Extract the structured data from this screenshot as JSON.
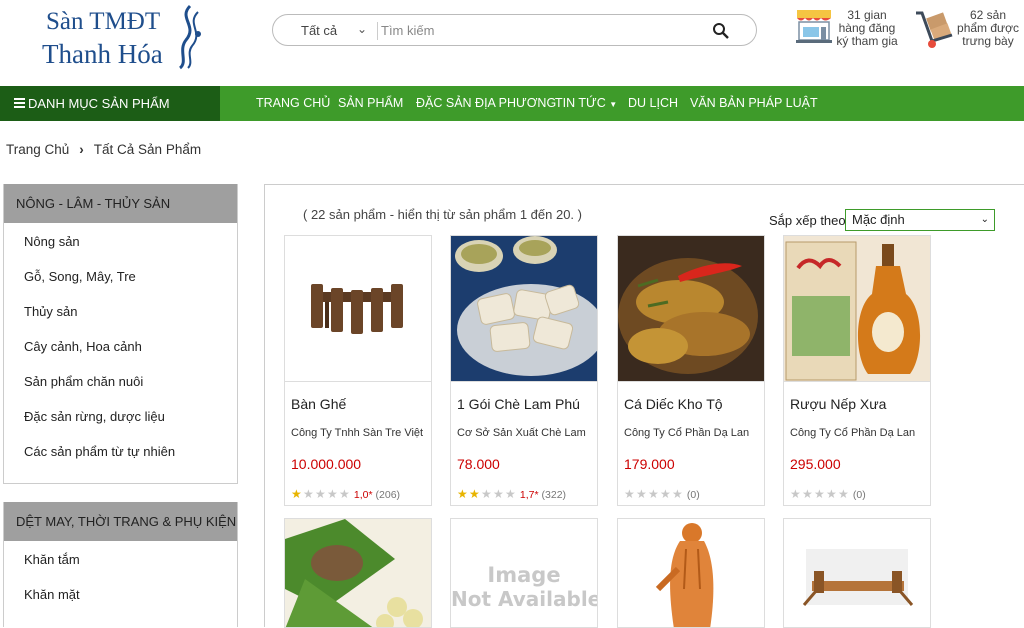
{
  "logo": {
    "line1": "Sàn TMĐT",
    "line2": "Thanh Hóa"
  },
  "search": {
    "category": "Tất cả",
    "placeholder": "Tìm kiếm"
  },
  "stats": [
    {
      "icon": "shop-stall-icon",
      "text": "31 gian hàng đăng ký tham gia"
    },
    {
      "icon": "hand-truck-icon",
      "text": "62 sản phẩm được trưng bày"
    }
  ],
  "nav": {
    "category_menu": "DANH MỤC SẢN PHẨM",
    "items": [
      "TRANG CHỦ",
      "SẢN PHẨM",
      "ĐẶC SẢN ĐỊA PHƯƠNG",
      "TIN TỨC",
      "DU LỊCH",
      "VĂN BẢN PHÁP LUẬT"
    ]
  },
  "breadcrumb": [
    "Trang Chủ",
    "Tất Cả Sản Phẩm"
  ],
  "sidebar": [
    {
      "title": "NÔNG - LÂM - THỦY SẢN",
      "items": [
        "Nông sản",
        "Gỗ, Song, Mây, Tre",
        "Thủy sản",
        "Cây cảnh, Hoa cảnh",
        "Sản phẩm chăn nuôi",
        "Đặc sản rừng, dược liệu",
        "Các sản phẩm từ tự nhiên"
      ]
    },
    {
      "title": "DỆT MAY, THỜI TRANG & PHỤ KIỆN",
      "items": [
        "Khăn tắm",
        "Khăn mặt"
      ]
    }
  ],
  "listing": {
    "count_text": "( 22 sản phẩm - hiển thị từ sản phẩm 1 đến 20. )",
    "sort_label": "Sắp xếp theo",
    "sort_value": "Mặc định"
  },
  "products": [
    {
      "name": "Bàn Ghế",
      "company": "Công Ty Tnhh Sàn Tre Việt",
      "price": "10.000.000",
      "stars": 1,
      "rating": "1,0*",
      "reviews": "(206)",
      "image": "table-chairs-image"
    },
    {
      "name": "1 Gói Chè Lam Phú",
      "company": "Cơ Sở Sản Xuất Chè Lam",
      "price": "78.000",
      "stars": 2,
      "rating": "1,7*",
      "reviews": "(322)",
      "image": "che-lam-image"
    },
    {
      "name": "Cá Diếc Kho Tộ",
      "company": "Công Ty Cổ Phần Dạ Lan",
      "price": "179.000",
      "stars": 0,
      "rating": "",
      "reviews": "(0)",
      "image": "braised-fish-image"
    },
    {
      "name": "Rượu Nếp Xưa",
      "company": "Công Ty Cổ Phần Dạ Lan",
      "price": "295.000",
      "stars": 0,
      "rating": "",
      "reviews": "(0)",
      "image": "rice-wine-image"
    }
  ],
  "second_row": [
    {
      "image": "nem-chua-image"
    },
    {
      "image": "image-not-available-placeholder",
      "text_line1": "Image",
      "text_line2": "Not Available"
    },
    {
      "image": "wooden-statue-image"
    },
    {
      "image": "bed-frame-image"
    }
  ],
  "colors": {
    "nav_green": "#3e9b2a",
    "nav_dark": "#1c5d16",
    "price_red": "#cc0000",
    "star_gold": "#e8b400",
    "logo_blue": "#1f4e8c"
  }
}
